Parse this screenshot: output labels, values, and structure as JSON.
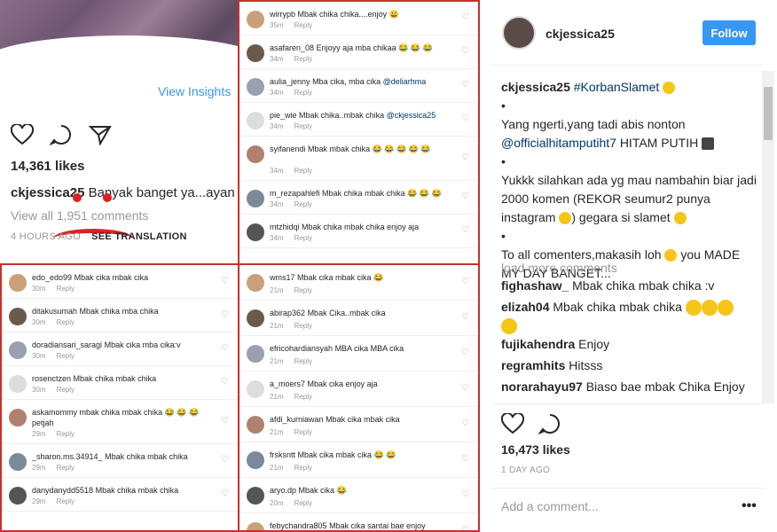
{
  "left_post": {
    "view_insights": "View Insights",
    "likes": "14,361 likes",
    "caption_user": "ckjessica25",
    "caption_text": " Banyak banget ya...ayan",
    "view_all": "View all 1,951 comments",
    "time": "4 HOURS AGO",
    "see_translation": "SEE TRANSLATION"
  },
  "panel_top_right": [
    {
      "user": "wirrypb",
      "text": "Mbak chika chika....enjoy",
      "emoji": "😀",
      "time": "35m",
      "reply": "Reply"
    },
    {
      "user": "asafaren_08",
      "text": "Enjoyy aja mba chikaa",
      "emoji": "😂 😂 😂",
      "time": "34m",
      "reply": "Reply"
    },
    {
      "user": "aulia_jenny",
      "text": "Mba cika, mba cika",
      "mention": "@deliarhma",
      "time": "34m",
      "reply": "Reply"
    },
    {
      "user": "pie_wie",
      "text": "Mbak chika..mbak chika",
      "mention": "@ckjessica25",
      "time": "34m",
      "reply": "Reply"
    },
    {
      "user": "syifanendi",
      "text": "Mbak mbak chika",
      "emoji": "😂 😂 😂 😂 😂",
      "time": "34m",
      "reply": "Reply"
    },
    {
      "user": "m_rezapahlefi",
      "text": "Mbak chika mbak chika",
      "emoji": "😂 😂 😂",
      "time": "34m",
      "reply": "Reply"
    },
    {
      "user": "mtzhidqi",
      "text": "Mbak chika mbak chika enjoy aja",
      "time": "34m",
      "reply": "Reply"
    }
  ],
  "panel_bottom_left": [
    {
      "user": "edo_edo99",
      "text": "Mbak cika mbak cika",
      "time": "30m",
      "reply": "Reply"
    },
    {
      "user": "ditakusumah",
      "text": "Mbak chika mba chika",
      "time": "30m",
      "reply": "Reply"
    },
    {
      "user": "doradiansari_saragi",
      "text": "Mbak cika mba cika:v",
      "time": "30m",
      "reply": "Reply"
    },
    {
      "user": "rosenctzen",
      "text": "Mbak chika mbak chika",
      "time": "30m",
      "reply": "Reply"
    },
    {
      "user": "askamommy",
      "text": "mbak chika mbak chika",
      "emoji": "😂 😂 😂",
      "extra": "petjah",
      "time": "29m",
      "reply": "Reply"
    },
    {
      "user": "_sharon.ms.34914_",
      "text": "Mbak chika mbak chika",
      "time": "29m",
      "reply": "Reply"
    },
    {
      "user": "danydanydd5518",
      "text": "Mbak chika mbak chika",
      "time": "29m",
      "reply": "Reply"
    }
  ],
  "panel_bottom_mid": [
    {
      "user": "wms17",
      "text": "Mbak cika mbak cika",
      "emoji": "😂",
      "time": "21m",
      "reply": "Reply"
    },
    {
      "user": "abirap362",
      "text": "Mbak Cika..mbak cika",
      "time": "21m",
      "reply": "Reply"
    },
    {
      "user": "efricohardiansyah",
      "text": "MBA cika MBA cika",
      "time": "21m",
      "reply": "Reply"
    },
    {
      "user": "a_moers7",
      "text": "Mbak cika enjoy aja",
      "time": "21m",
      "reply": "Reply"
    },
    {
      "user": "afdi_kurniawan",
      "text": "Mbak cika mbak cika",
      "time": "21m",
      "reply": "Reply"
    },
    {
      "user": "frsksntt",
      "text": "Mbak cika mbak cika",
      "emoji": "😂 😂",
      "time": "21m",
      "reply": "Reply"
    },
    {
      "user": "aryo.dp",
      "text": "Mbak cika",
      "emoji": "😂",
      "time": "20m",
      "reply": "Reply"
    },
    {
      "user": "febychandra805",
      "text": "Mbak cika santai bae enjoy",
      "time": "",
      "reply": ""
    }
  ],
  "right_post": {
    "username": "ckjessica25",
    "follow": "Follow",
    "cap_user": "ckjessica25",
    "cap_tag": "#KorbanSlamet",
    "bullet": "•",
    "line1": "Yang ngerti,yang tadi abis nonton",
    "mention": "@officialhitamputiht7",
    "line1b": "HITAM PUTIH",
    "line2": "Yukkk silahkan ada yg mau nambahin biar jadi 2000 komen (REKOR seumur2 punya instagram",
    "line2b": ") gegara si slamet",
    "line3": "To all comenters,makasih loh",
    "line3b": "you MADE MY DAY BANGET...",
    "load_more": "load more comments",
    "comments": [
      {
        "user": "fighashaw_",
        "text": "Mbak chika mbak chika :v"
      },
      {
        "user": "elizah04",
        "text": "Mbak chika mbak chika"
      },
      {
        "user": "fujikahendra",
        "text": "Enjoy"
      },
      {
        "user": "regramhits",
        "text": "Hitsss"
      },
      {
        "user": "norarahayu97",
        "text": "Biaso bae mbak Chika Enjoy"
      }
    ],
    "likes": "16,473 likes",
    "time": "1 DAY AGO",
    "add_comment": "Add a comment...",
    "more": "•••"
  }
}
